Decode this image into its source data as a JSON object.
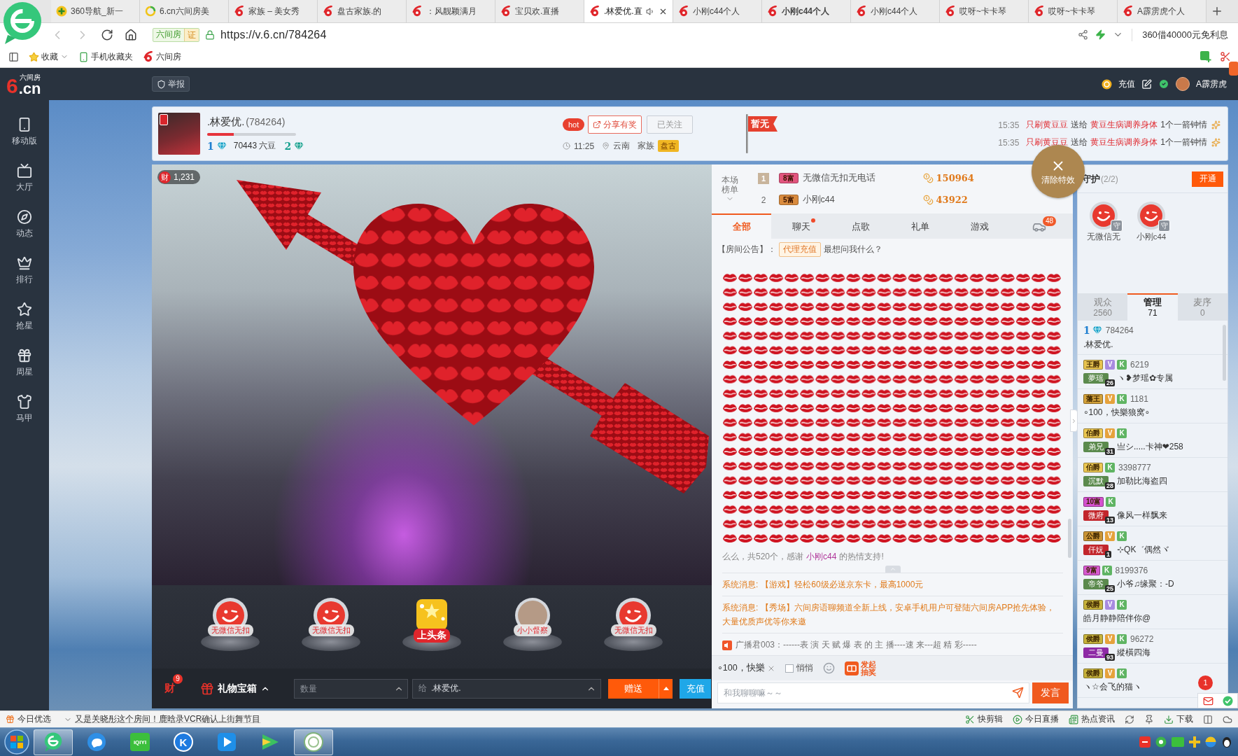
{
  "browser": {
    "tabs": [
      {
        "label": "360导航_新一",
        "kind": "nav",
        "selected": false,
        "bold": false,
        "audio": false
      },
      {
        "label": "6.cn六间房美",
        "kind": "loading",
        "selected": false,
        "bold": false,
        "audio": false
      },
      {
        "label": "家族 – 美女秀",
        "kind": "site",
        "selected": false,
        "bold": false,
        "audio": false
      },
      {
        "label": "盘古家族.的",
        "kind": "site",
        "selected": false,
        "bold": false,
        "audio": false
      },
      {
        "label": "：风靓颖满月",
        "kind": "site",
        "selected": false,
        "bold": false,
        "audio": false
      },
      {
        "label": "宝贝欢.直播",
        "kind": "site",
        "selected": false,
        "bold": false,
        "audio": false
      },
      {
        "label": ".林爱优.直",
        "kind": "site",
        "selected": true,
        "bold": false,
        "audio": true
      },
      {
        "label": "小刚c44个人",
        "kind": "site",
        "selected": false,
        "bold": false,
        "audio": false
      },
      {
        "label": "小刚c44个人",
        "kind": "site",
        "selected": false,
        "bold": true,
        "audio": false
      },
      {
        "label": "小刚c44个人",
        "kind": "site",
        "selected": false,
        "bold": false,
        "audio": false
      },
      {
        "label": "哎呀~卡卡琴",
        "kind": "site",
        "selected": false,
        "bold": false,
        "audio": false
      },
      {
        "label": "哎呀~卡卡琴",
        "kind": "site",
        "selected": false,
        "bold": false,
        "audio": false
      },
      {
        "label": "A霹雳虎个人",
        "kind": "site",
        "selected": false,
        "bold": false,
        "audio": false
      }
    ],
    "nav": {
      "back_disabled": true,
      "forward_disabled": true
    },
    "address": {
      "site_badge": "六间房",
      "verified": "证",
      "url": "https://v.6.cn/784264"
    },
    "promo": "360借40000元免利息",
    "bookmarks": [
      {
        "label": "收藏",
        "kind": "favorites"
      },
      {
        "label": "手机收藏夹",
        "kind": "mobile"
      },
      {
        "label": "六间房",
        "kind": "site"
      }
    ]
  },
  "site_header": {
    "logo": {
      "mark": "6",
      "name": ".cn",
      "tagline": "六间房"
    },
    "report": "举报",
    "recharge": "充值",
    "username": "A霹雳虎"
  },
  "sidebar": {
    "items": [
      {
        "label": "移动版",
        "kind": "phone"
      },
      {
        "label": "大厅",
        "kind": "tv"
      },
      {
        "label": "动态",
        "kind": "compass"
      },
      {
        "label": "排行",
        "kind": "crown"
      },
      {
        "label": "抢星",
        "kind": "star"
      },
      {
        "label": "周星",
        "kind": "gift"
      },
      {
        "label": "马甲",
        "kind": "shirt"
      }
    ]
  },
  "room": {
    "anchor": {
      "name": ".林爱优.",
      "id": "(784264)",
      "level": 0.3,
      "wealth_level": "1",
      "beans": "70443 六豆",
      "fan_level": "2",
      "hot": "hot",
      "share": "分享有奖",
      "follow": "已关注",
      "followed": true,
      "time": "11:25",
      "location": "云南",
      "family_label": "家族",
      "family": "盘古"
    },
    "flag": "暂无",
    "gift_feed": [
      {
        "time": "15:35",
        "sender": "只刷黄豆豆",
        "verb": "送给",
        "receiver": "黄豆生病调养身体",
        "gift": "1个一箭钟情"
      },
      {
        "time": "15:35",
        "sender": "只刷黄豆豆",
        "verb": "送给",
        "receiver": "黄豆生病调养身体",
        "gift": "1个一箭钟情"
      }
    ]
  },
  "video": {
    "viewer_icon": "财",
    "viewers": "1,231"
  },
  "gift_bar": {
    "items": [
      {
        "label": "无微信无扣",
        "kind": "default"
      },
      {
        "label": "无微信无扣",
        "kind": "default"
      },
      {
        "label": "上头条",
        "kind": "headline"
      },
      {
        "label": "小小督察",
        "kind": "photo"
      },
      {
        "label": "无微信无扣",
        "kind": "default"
      }
    ]
  },
  "controls": {
    "wealth_icon": "财",
    "wealth_count": "9",
    "gift_box": "礼物宝箱",
    "quantity_placeholder": "数量",
    "to_label": "给",
    "to_value": ".林爱优.",
    "send": "赠送",
    "recharge": "充值"
  },
  "chat": {
    "ranking_label": "本场榜单",
    "ranking": [
      {
        "rank": "1",
        "kind": "medal",
        "badge": "8富",
        "color": "#e2557e",
        "name": "无微信无扣无电话",
        "score": "150964"
      },
      {
        "rank": "2",
        "kind": "plain",
        "badge": "5富",
        "color": "#d98b3e",
        "name": "小刚c44",
        "score": "43922"
      }
    ],
    "clear_effects": "清除特效",
    "tabs": [
      {
        "label": "全部",
        "kind": "text",
        "selected": true,
        "dot": false
      },
      {
        "label": "聊天",
        "kind": "text",
        "selected": false,
        "dot": true
      },
      {
        "label": "点歌",
        "kind": "text",
        "selected": false,
        "dot": false
      },
      {
        "label": "礼单",
        "kind": "text",
        "selected": false,
        "dot": false
      },
      {
        "label": "游戏",
        "kind": "text",
        "selected": false,
        "dot": false
      },
      {
        "kind": "car",
        "count": "48",
        "selected": false,
        "dot": false
      }
    ],
    "notice": {
      "label": "【房间公告】：",
      "tag": "代理充值",
      "text": "最想问我什么？"
    },
    "messages": [
      {
        "kind": "thanks",
        "text": "么么，共520个，感谢",
        "user": "小刚c44",
        "suffix": "的热情支持!"
      },
      {
        "kind": "system",
        "prefix": "系统消息:",
        "text": "【游戏】轻松60级必送京东卡，最高1000元"
      },
      {
        "kind": "system",
        "prefix": "系统消息:",
        "text": "【秀场】六间房语聊频道全新上线，安卓手机用户可登陆六间房APP抢先体验，大量优质声优等你来邀"
      },
      {
        "kind": "broadcast",
        "text": "广播君003：------表 演 天 赋 爆 表 的 主 播----速 来---超 精 彩-----"
      }
    ],
    "quick_phrase": "∘100，快樂",
    "whisper": {
      "label": "悄悄",
      "checked": false
    },
    "lottery": "发起抽奖",
    "input_placeholder": "和我聊聊嘛～～",
    "send": "发言"
  },
  "side_panel": {
    "guard_title": "守护",
    "guard_count": "(2/2)",
    "open": "开通",
    "guards": [
      {
        "name": "无微信无",
        "badge": "守"
      },
      {
        "name": "小刚c44",
        "badge": "守"
      }
    ],
    "tabs": [
      {
        "label": "观众",
        "count": "2560",
        "selected": false
      },
      {
        "label": "管理",
        "count": "71",
        "selected": true
      },
      {
        "label": "麦序",
        "count": "0",
        "selected": false
      }
    ],
    "users": [
      {
        "kind": "anchor",
        "level": "1",
        "id": "784264",
        "name": ".林爱优."
      },
      {
        "kind": "member",
        "rank": {
          "label": "王爵",
          "color": "#e8c450"
        },
        "vip": {
          "label": "V",
          "color": "#a88be0"
        },
        "k": "K",
        "id": "6219",
        "fan": {
          "label": "夢瑶",
          "level": "26",
          "color": "#5b8a4d"
        },
        "name": "ヽ❥梦瑶✿专属"
      },
      {
        "kind": "member",
        "rank": {
          "label": "藩王",
          "color": "#d4a23a"
        },
        "vip": {
          "label": "V",
          "color": "#e6a23c"
        },
        "k": "K",
        "id": "1181",
        "name": "∘100，快樂狼窝∘"
      },
      {
        "kind": "member",
        "rank": {
          "label": "伯爵",
          "color": "#ebc752"
        },
        "vip": {
          "label": "V",
          "color": "#e6a23c"
        },
        "k": "K",
        "fan": {
          "label": "弟兄",
          "level": "31",
          "color": "#5b8a4d"
        },
        "name": "亗シ.....卡神❤258"
      },
      {
        "kind": "member",
        "rank": {
          "label": "伯爵",
          "color": "#ebc752"
        },
        "k": "K",
        "id": "3398777",
        "fan": {
          "label": "沉默",
          "level": "28",
          "color": "#5b8a4d"
        },
        "name": "加勒比海盗四"
      },
      {
        "kind": "member",
        "rank": {
          "label": "10富",
          "color": "#d551cf"
        },
        "k": "K",
        "fan": {
          "label": "微府",
          "level": "13",
          "color": "#c2262c"
        },
        "name": "像风一样飘来"
      },
      {
        "kind": "member",
        "rank": {
          "label": "公爵",
          "color": "#c99435"
        },
        "vip": {
          "label": "V",
          "color": "#e6a23c"
        },
        "k": "K",
        "fan": {
          "label": "仟妧",
          "level": "1",
          "color": "#c2262c"
        },
        "name": "⊹QK゛偶然ヾ"
      },
      {
        "kind": "member",
        "rank": {
          "label": "9富",
          "color": "#d75ad0"
        },
        "k": "K",
        "id": "8199376",
        "fan": {
          "label": "帝爷",
          "level": "25",
          "color": "#5b8a4d"
        },
        "name": "小爷♫缘聚：-D"
      },
      {
        "kind": "member",
        "rank": {
          "label": "侯爵",
          "color": "#c7b23b"
        },
        "vip": {
          "label": "V",
          "color": "#a88be0"
        },
        "k": "K",
        "name": "皓月静静陪伴你@"
      },
      {
        "kind": "member",
        "rank": {
          "label": "侯爵",
          "color": "#c7b23b"
        },
        "vip": {
          "label": "V",
          "color": "#e6a23c"
        },
        "k": "K",
        "id": "96272",
        "fan": {
          "label": "二曼",
          "level": "93",
          "color": "#8e2aa5"
        },
        "name": "縱橫四海"
      },
      {
        "kind": "member",
        "rank": {
          "label": "侯爵",
          "color": "#c7b23b"
        },
        "vip": {
          "label": "V",
          "color": "#e6a23c"
        },
        "k": "K",
        "name": "ヽ☆会飞的猫ヽ"
      }
    ],
    "mail_count": "1"
  },
  "status_bar": {
    "picks": "今日优选",
    "headline": "又是关晓彤这个房间！鹿晗录VCR确认上街舞节目",
    "links": [
      {
        "label": "快剪辑",
        "kind": "cut"
      },
      {
        "label": "今日直播",
        "kind": "live"
      },
      {
        "label": "热点资讯",
        "kind": "news"
      },
      {
        "kind": "refresh"
      },
      {
        "kind": "pin"
      },
      {
        "label": "下载",
        "kind": "download"
      },
      {
        "kind": "columns"
      },
      {
        "kind": "cloud"
      }
    ]
  },
  "taskbar": {
    "apps": [
      {
        "kind": "browser",
        "active": true
      },
      {
        "kind": "bubble",
        "active": false
      },
      {
        "kind": "tile",
        "glyph": "iQIYI",
        "active": false
      },
      {
        "kind": "circle",
        "glyph": "K",
        "active": false
      },
      {
        "kind": "play",
        "active": false
      },
      {
        "kind": "play_alt",
        "active": false
      },
      {
        "kind": "emblem",
        "active": true
      }
    ]
  }
}
